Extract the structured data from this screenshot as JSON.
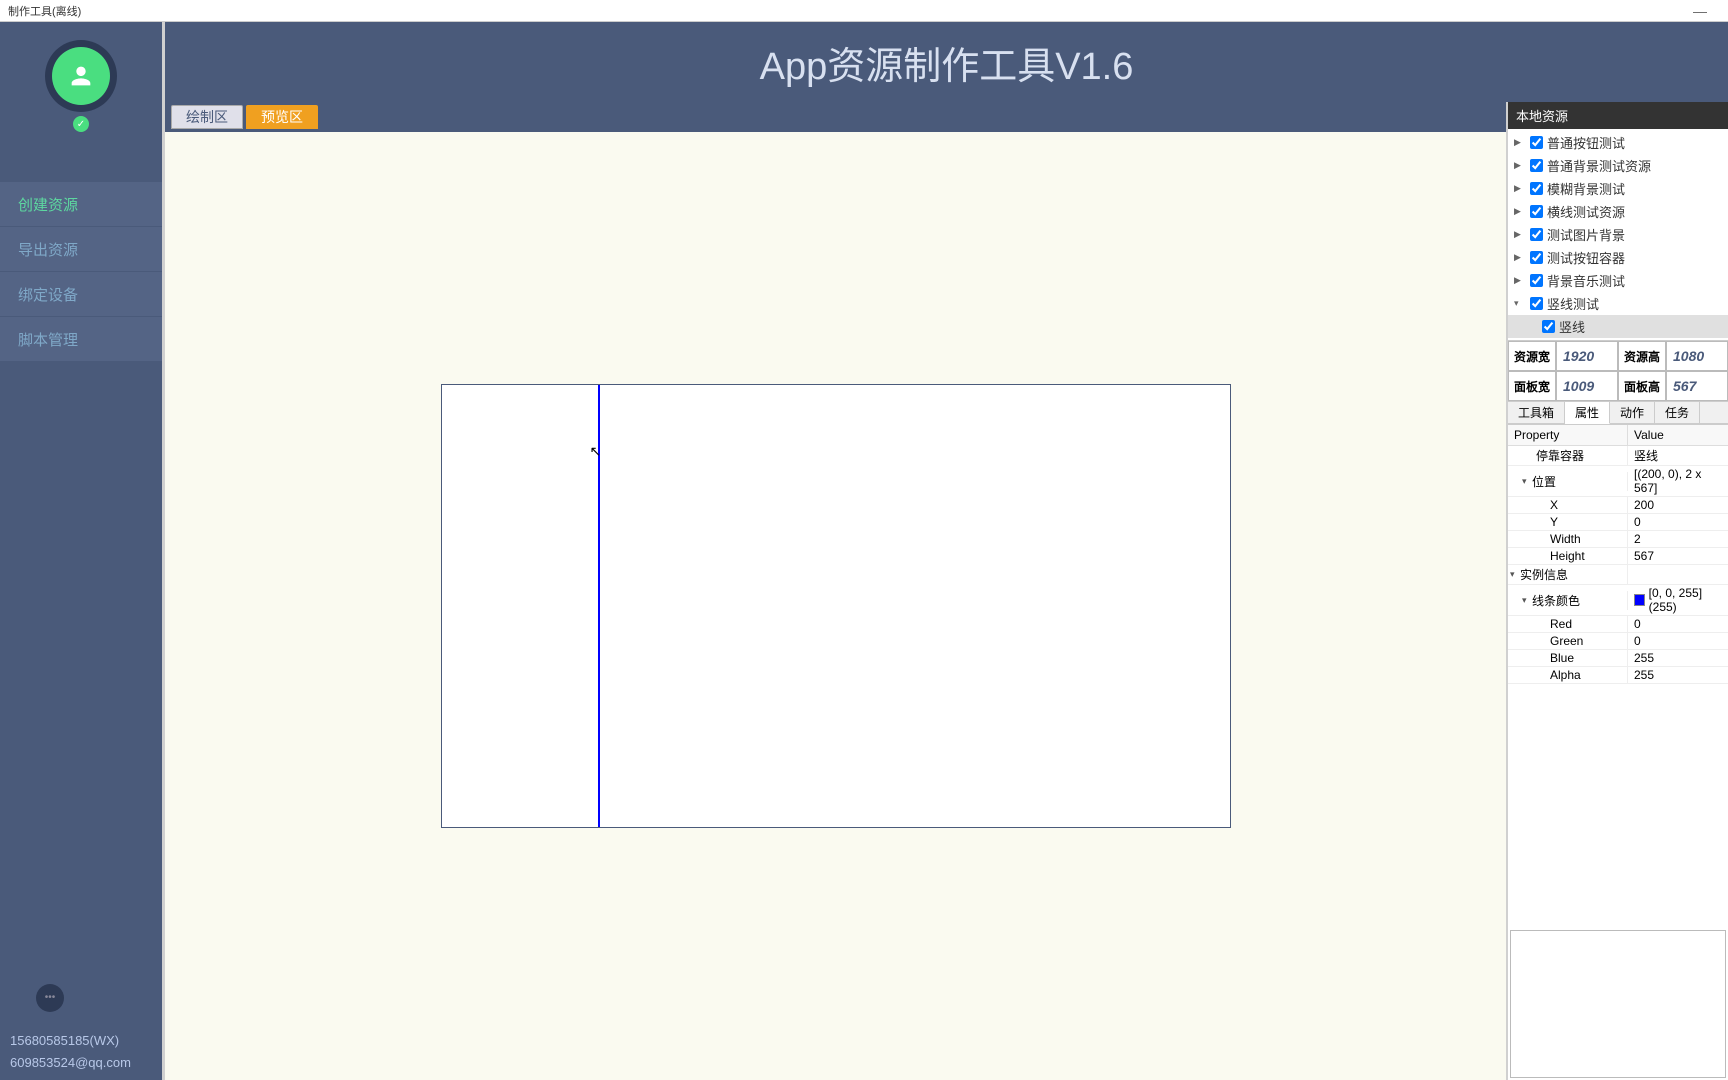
{
  "window": {
    "title": "制作工具(离线)"
  },
  "header": {
    "title": "App资源制作工具V1.6"
  },
  "sidebar": {
    "nav": [
      {
        "label": "创建资源",
        "active": true
      },
      {
        "label": "导出资源"
      },
      {
        "label": "绑定设备"
      },
      {
        "label": "脚本管理"
      }
    ],
    "contact_wx": "15680585185(WX)",
    "contact_qq": "609853524@qq.com"
  },
  "tabs": {
    "draw": "绘制区",
    "preview": "预览区"
  },
  "resources": {
    "header": "本地资源",
    "items": [
      {
        "label": "普通按钮测试"
      },
      {
        "label": "普通背景测试资源"
      },
      {
        "label": "模糊背景测试"
      },
      {
        "label": "横线测试资源"
      },
      {
        "label": "测试图片背景"
      },
      {
        "label": "测试按钮容器"
      },
      {
        "label": "背景音乐测试"
      },
      {
        "label": "竖线测试",
        "expanded": true,
        "children": [
          {
            "label": "竖线"
          }
        ]
      }
    ]
  },
  "dims": {
    "res_w_label": "资源宽",
    "res_w": "1920",
    "res_h_label": "资源高",
    "res_h": "1080",
    "panel_w_label": "面板宽",
    "panel_w": "1009",
    "panel_h_label": "面板高",
    "panel_h": "567"
  },
  "prop_tabs": {
    "toolbox": "工具箱",
    "props": "属性",
    "actions": "动作",
    "tasks": "任务"
  },
  "prop_grid": {
    "header_prop": "Property",
    "header_val": "Value",
    "rows": {
      "dock_container_k": "停靠容器",
      "dock_container_v": "竖线",
      "pos_k": "位置",
      "pos_v": "[(200, 0), 2 x 567]",
      "x_k": "X",
      "x_v": "200",
      "y_k": "Y",
      "y_v": "0",
      "w_k": "Width",
      "w_v": "2",
      "h_k": "Height",
      "h_v": "567",
      "inst_k": "实例信息",
      "linecolor_k": "线条颜色",
      "linecolor_v": "[0, 0, 255] (255)",
      "red_k": "Red",
      "red_v": "0",
      "green_k": "Green",
      "green_v": "0",
      "blue_k": "Blue",
      "blue_v": "255",
      "alpha_k": "Alpha",
      "alpha_v": "255"
    }
  }
}
